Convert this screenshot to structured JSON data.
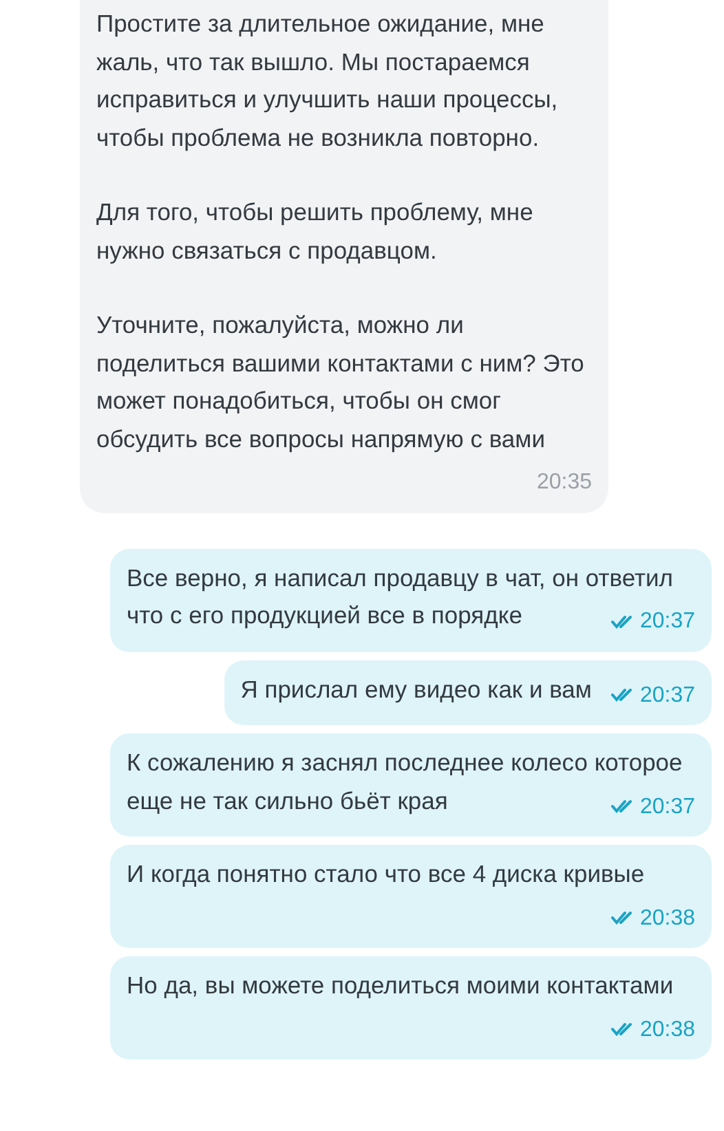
{
  "messages": [
    {
      "kind": "incoming",
      "paragraphs": [
        "Простите за длительное ожидание, мне жаль, что так вышло. Мы постараемся исправиться и улучшить наши процессы, чтобы проблема не возникла повторно.",
        "Для того, чтобы решить проблему, мне нужно связаться с продавцом.",
        "Уточните, пожалуйста, можно ли поделиться вашими контактами с ним? Это может понадобиться, чтобы он смог обсудить все вопросы напрямую с вами"
      ],
      "time": "20:35",
      "read": false
    },
    {
      "kind": "outgoing",
      "paragraphs": [
        "Все верно, я написал продавцу в чат, он ответил что с его продукцией все в порядке"
      ],
      "time": "20:37",
      "read": true
    },
    {
      "kind": "outgoing",
      "paragraphs": [
        "Я прислал ему видео как и вам"
      ],
      "time": "20:37",
      "read": true
    },
    {
      "kind": "outgoing",
      "paragraphs": [
        "К сожалению я заснял последнее колесо которое еще не так сильно бьёт края"
      ],
      "time": "20:37",
      "read": true
    },
    {
      "kind": "outgoing",
      "paragraphs": [
        "И когда понятно стало что все 4 диска кривые"
      ],
      "time": "20:38",
      "read": true
    },
    {
      "kind": "outgoing",
      "paragraphs": [
        "Но да, вы можете поделиться моими контактами"
      ],
      "time": "20:38",
      "read": true
    }
  ]
}
